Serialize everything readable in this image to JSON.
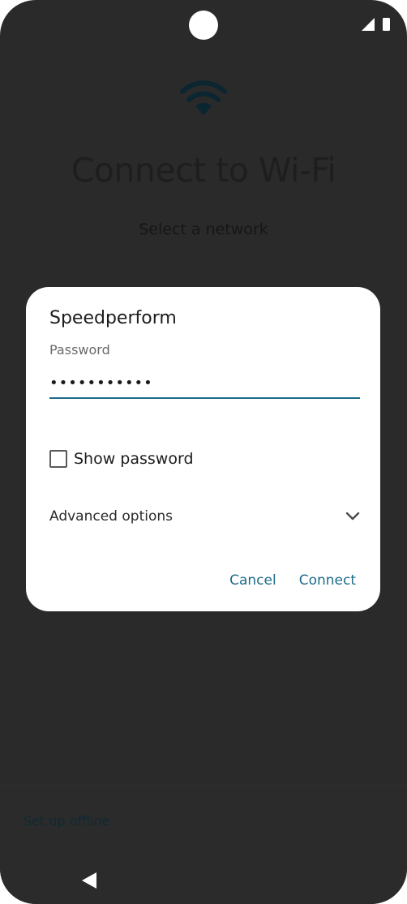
{
  "screen": {
    "title": "Connect to Wi-Fi",
    "subtitle": "Select a network"
  },
  "dialog": {
    "network_name": "Speedperform",
    "password_label": "Password",
    "password_value": "•••••••••••",
    "show_password_label": "Show password",
    "show_password_checked": false,
    "advanced_options_label": "Advanced options",
    "cancel_label": "Cancel",
    "connect_label": "Connect"
  },
  "footer": {
    "setup_offline_label": "Set up offline"
  },
  "icons": {
    "wifi": "wifi-icon",
    "signal": "signal-icon",
    "battery": "battery-icon",
    "chevron": "chevron-down-icon",
    "back": "back-icon"
  },
  "colors": {
    "accent": "#1d6b8a",
    "screen_background": "#2a2a2a",
    "dialog_background": "#ffffff"
  }
}
